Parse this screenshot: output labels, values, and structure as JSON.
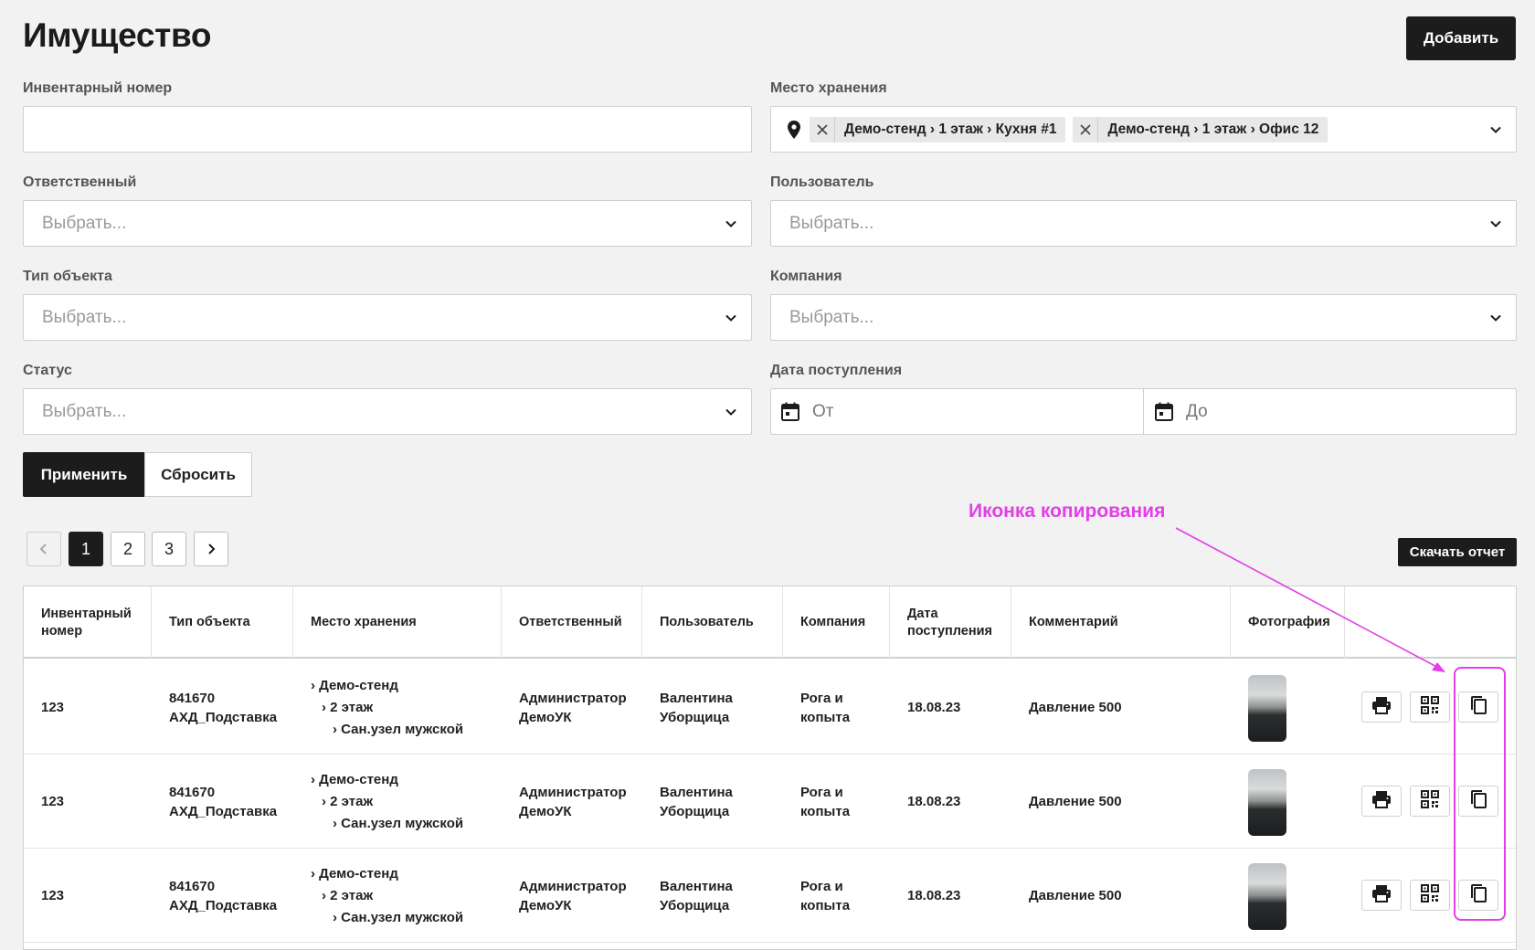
{
  "header": {
    "title": "Имущество",
    "add_label": "Добавить"
  },
  "filters": {
    "inventory": {
      "label": "Инвентарный номер",
      "value": ""
    },
    "location": {
      "label": "Место хранения",
      "tags": [
        "Демо-стенд › 1 этаж › Кухня #1",
        "Демо-стенд › 1 этаж › Офис 12"
      ]
    },
    "responsible": {
      "label": "Ответственный",
      "placeholder": "Выбрать..."
    },
    "user": {
      "label": "Пользователь",
      "placeholder": "Выбрать..."
    },
    "object_type": {
      "label": "Тип объекта",
      "placeholder": "Выбрать..."
    },
    "company": {
      "label": "Компания",
      "placeholder": "Выбрать..."
    },
    "status": {
      "label": "Статус",
      "placeholder": "Выбрать..."
    },
    "date": {
      "label": "Дата поступления",
      "from": "От",
      "to": "До"
    },
    "apply_label": "Применить",
    "reset_label": "Сбросить"
  },
  "pagination": {
    "pages": [
      "1",
      "2",
      "3"
    ],
    "current": "1"
  },
  "report_label": "Скачать отчет",
  "annotation": {
    "text": "Иконка копирования",
    "color": "#e23fe8"
  },
  "table": {
    "headers": {
      "inv1": "Инвентарный",
      "inv2": "номер",
      "type": "Тип объекта",
      "loc": "Место хранения",
      "resp": "Ответственный",
      "user": "Пользователь",
      "company": "Компания",
      "date1": "Дата",
      "date2": "поступления",
      "comment": "Комментарий",
      "photo": "Фотография"
    },
    "rows": [
      {
        "inv": "123",
        "type1": "841670",
        "type2": "АХД_Подставка",
        "loc1": "› Демо-стенд",
        "loc2": "› 2 этаж",
        "loc3": "› Сан.узел мужской",
        "resp1": "Администратор",
        "resp2": "ДемоУК",
        "user1": "Валентина",
        "user2": "Уборщица",
        "company1": "Рога и",
        "company2": "копыта",
        "date": "18.08.23",
        "comment": "Давление 500"
      },
      {
        "inv": "123",
        "type1": "841670",
        "type2": "АХД_Подставка",
        "loc1": "› Демо-стенд",
        "loc2": "› 2 этаж",
        "loc3": "› Сан.узел мужской",
        "resp1": "Администратор",
        "resp2": "ДемоУК",
        "user1": "Валентина",
        "user2": "Уборщица",
        "company1": "Рога и",
        "company2": "копыта",
        "date": "18.08.23",
        "comment": "Давление 500"
      },
      {
        "inv": "123",
        "type1": "841670",
        "type2": "АХД_Подставка",
        "loc1": "› Демо-стенд",
        "loc2": "› 2 этаж",
        "loc3": "› Сан.узел мужской",
        "resp1": "Администратор",
        "resp2": "ДемоУК",
        "user1": "Валентина",
        "user2": "Уборщица",
        "company1": "Рога и",
        "company2": "копыта",
        "date": "18.08.23",
        "comment": "Давление 500"
      }
    ],
    "row_actions": [
      "printer-icon",
      "qr-code-icon",
      "copy-icon"
    ]
  }
}
